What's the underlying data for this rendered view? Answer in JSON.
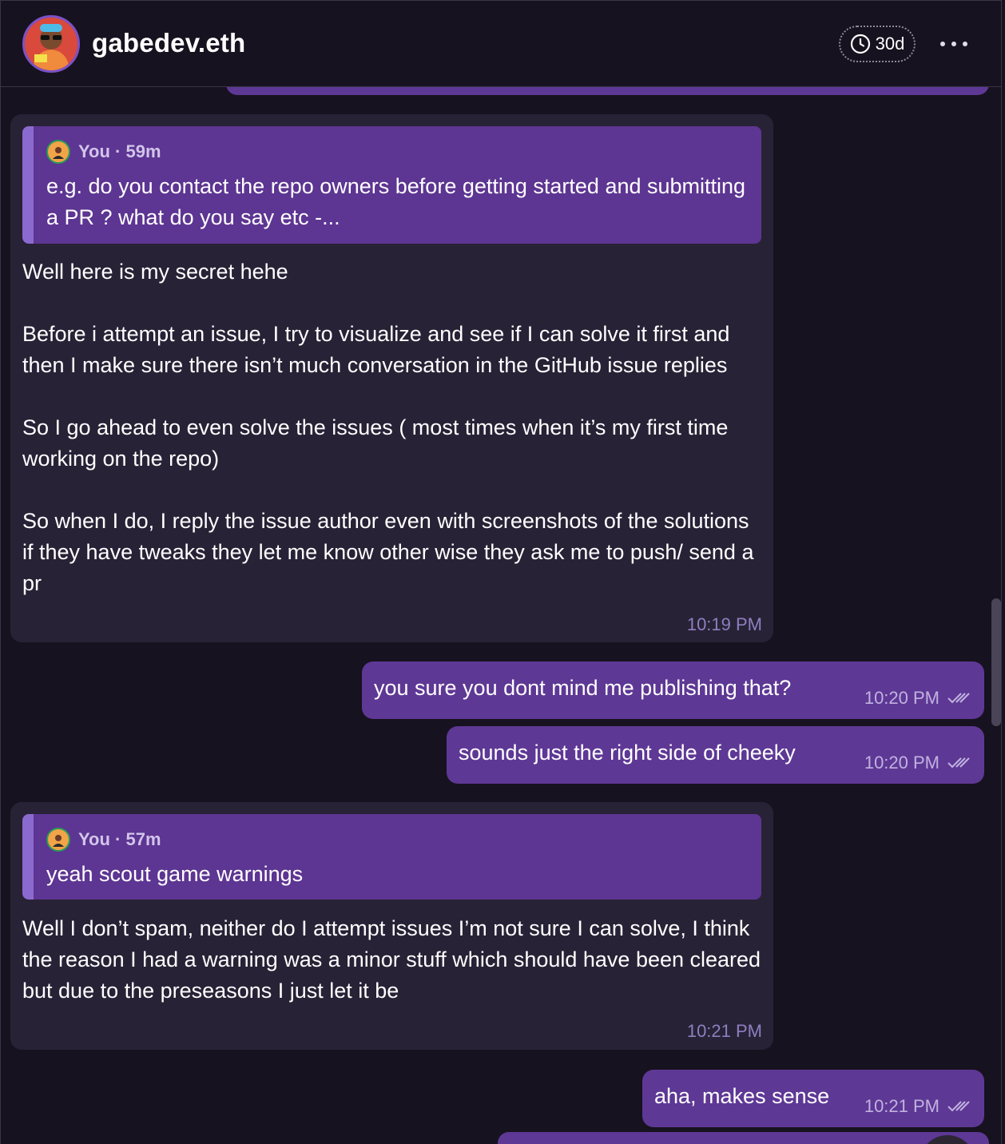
{
  "header": {
    "title": "gabedev.eth",
    "timer_label": "30d",
    "avatar_icon": "profile-avatar",
    "timer_icon": "clock-icon",
    "more_icon": "more-horizontal-icon"
  },
  "messages": [
    {
      "quote": {
        "author": "You · 59m",
        "text": "e.g. do you contact the repo owners before getting started and submitting a PR ? what do you say etc -..."
      },
      "text": "Well here is my secret hehe\n\nBefore i attempt an issue, I try to visualize and see if I can solve it first and then I make sure there isn’t much conversation in the GitHub issue replies\n\nSo I go ahead to even solve the issues ( most times when it’s my first time working on the repo)\n\nSo when I do, I reply the issue author even with screenshots of the solutions if they have tweaks they let me know other wise they ask me to push/ send a pr",
      "time": "10:19 PM"
    },
    {
      "outgoing": true,
      "text": "you sure you dont mind me publishing that?",
      "time": "10:20 PM"
    },
    {
      "outgoing": true,
      "text": "sounds just the right side of cheeky",
      "time": "10:20 PM"
    },
    {
      "quote": {
        "author": "You · 57m",
        "text": "yeah scout game warnings"
      },
      "text": "Well I don’t spam, neither do I attempt issues I’m not sure I can solve, I think the reason I had a warning was a minor stuff which should have been cleared but due to the preseasons I just let it be",
      "time": "10:21 PM"
    },
    {
      "outgoing": true,
      "text": "aha, makes sense",
      "time": "10:21 PM"
    }
  ],
  "colors": {
    "background": "#17121f",
    "incoming_bubble": "#282236",
    "outgoing_bubble": "#5e3895",
    "quote_block": "#5d3592",
    "quote_bar": "#8b6ad0",
    "timestamp_in": "#8e7fc0"
  }
}
